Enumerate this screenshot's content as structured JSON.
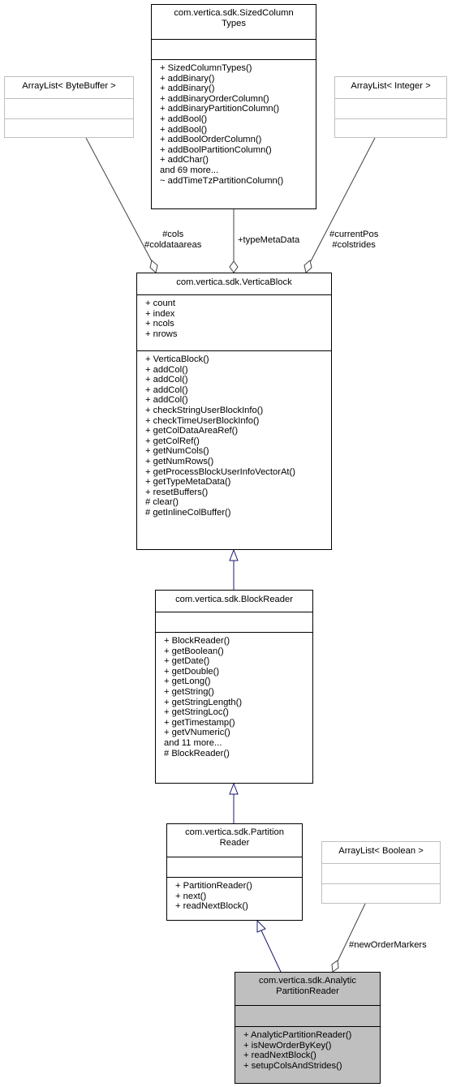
{
  "diagram": {
    "type": "UML class collaboration diagram",
    "classes": {
      "sized_column_types": {
        "title_line1": "com.vertica.sdk.SizedColumn",
        "title_line2": "Types",
        "attributes": [],
        "methods": [
          "+ SizedColumnTypes()",
          "+ addBinary()",
          "+ addBinary()",
          "+ addBinaryOrderColumn()",
          "+ addBinaryPartitionColumn()",
          "+ addBool()",
          "+ addBool()",
          "+ addBoolOrderColumn()",
          "+ addBoolPartitionColumn()",
          "+ addChar()",
          "and 69 more...",
          "~ addTimeTzPartitionColumn()"
        ]
      },
      "arraylist_bytebuffer": {
        "title": "ArrayList< ByteBuffer >"
      },
      "arraylist_integer": {
        "title": "ArrayList< Integer >"
      },
      "vertica_block": {
        "title": "com.vertica.sdk.VerticaBlock",
        "attributes": [
          "+ count",
          "+ index",
          "+ ncols",
          "+ nrows"
        ],
        "methods": [
          "+ VerticaBlock()",
          "+ addCol()",
          "+ addCol()",
          "+ addCol()",
          "+ addCol()",
          "+ checkStringUserBlockInfo()",
          "+ checkTimeUserBlockInfo()",
          "+ getColDataAreaRef()",
          "+ getColRef()",
          "+ getNumCols()",
          "+ getNumRows()",
          "+ getProcessBlockUserInfoVectorAt()",
          "+ getTypeMetaData()",
          "+ resetBuffers()",
          "# clear()",
          "# getInlineColBuffer()"
        ]
      },
      "block_reader": {
        "title": "com.vertica.sdk.BlockReader",
        "attributes": [],
        "methods": [
          "+ BlockReader()",
          "+ getBoolean()",
          "+ getDate()",
          "+ getDouble()",
          "+ getLong()",
          "+ getString()",
          "+ getStringLength()",
          "+ getStringLoc()",
          "+ getTimestamp()",
          "+ getVNumeric()",
          "and 11 more...",
          "# BlockReader()"
        ]
      },
      "partition_reader": {
        "title_line1": "com.vertica.sdk.Partition",
        "title_line2": "Reader",
        "attributes": [],
        "methods": [
          "+ PartitionReader()",
          "+ next()",
          "+ readNextBlock()"
        ]
      },
      "arraylist_boolean": {
        "title": "ArrayList< Boolean >"
      },
      "analytic_partition_reader": {
        "title_line1": "com.vertica.sdk.Analytic",
        "title_line2": "PartitionReader",
        "attributes": [],
        "methods": [
          "+ AnalyticPartitionReader()",
          "+ isNewOrderByKey()",
          "+ readNextBlock()",
          "+ setupColsAndStrides()"
        ]
      }
    },
    "edge_labels": {
      "cols": "#cols",
      "coldataareas": "#coldataareas",
      "type_meta_data": "+typeMetaData",
      "current_pos": "#currentPos",
      "colstrides": "#colstrides",
      "new_order_markers": "#newOrderMarkers"
    },
    "colors": {
      "inheritance_edge": "#191970",
      "aggregation_edge": "#404040",
      "focus_fill": "#bfbfbf",
      "external_border": "#bfbfbf"
    }
  }
}
